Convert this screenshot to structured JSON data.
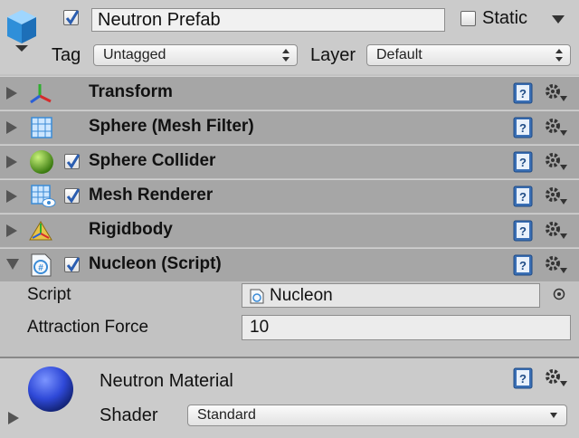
{
  "gameobject": {
    "name": "Neutron Prefab",
    "active": true,
    "static_label": "Static",
    "static_checked": false,
    "tag_label": "Tag",
    "tag_value": "Untagged",
    "layer_label": "Layer",
    "layer_value": "Default"
  },
  "components": [
    {
      "title": "Transform",
      "icon": "transform-axes-icon",
      "has_toggle": false,
      "expanded": false
    },
    {
      "title": "Sphere (Mesh Filter)",
      "icon": "mesh-filter-grid-icon",
      "has_toggle": false,
      "expanded": false
    },
    {
      "title": "Sphere Collider",
      "icon": "sphere-collider-green-ball-icon",
      "has_toggle": true,
      "enabled": true,
      "expanded": false
    },
    {
      "title": "Mesh Renderer",
      "icon": "mesh-renderer-icon",
      "has_toggle": true,
      "enabled": true,
      "expanded": false
    },
    {
      "title": "Rigidbody",
      "icon": "rigidbody-icon",
      "has_toggle": false,
      "expanded": false
    },
    {
      "title": "Nucleon (Script)",
      "icon": "csharp-script-icon",
      "has_toggle": true,
      "enabled": true,
      "expanded": true
    }
  ],
  "script_component": {
    "script_label": "Script",
    "script_value": "Nucleon",
    "attraction_label": "Attraction Force",
    "attraction_value": "10"
  },
  "material": {
    "name": "Neutron Material",
    "shader_label": "Shader",
    "shader_value": "Standard",
    "preview_color": "#2f49d8"
  },
  "colors": {
    "component_header": "#a6a6a6",
    "panel_background": "#c2c2c2",
    "checkmark": "#2a5db0"
  }
}
